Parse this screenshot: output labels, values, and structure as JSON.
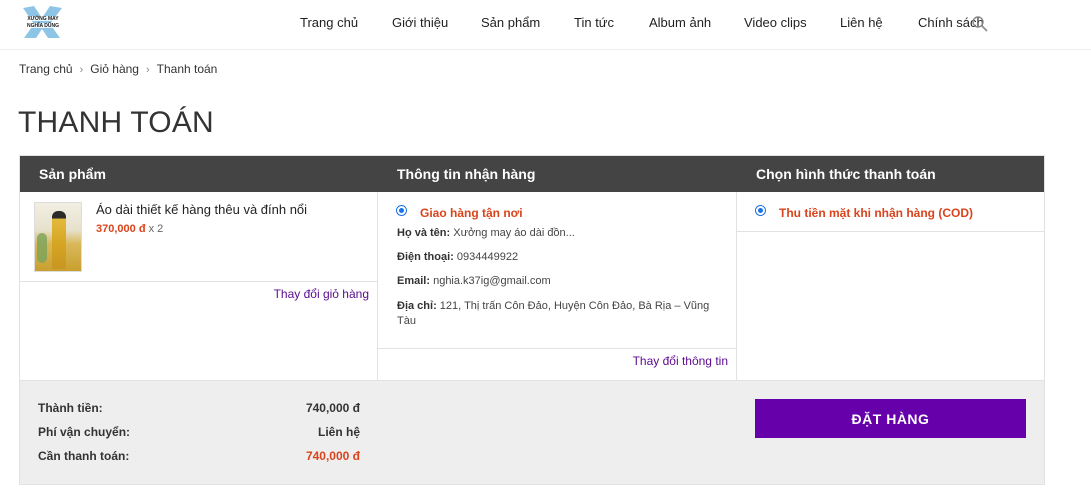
{
  "header": {
    "logo_alt": "XƯỞNG MAY NGHĨA DŨNG",
    "nav": [
      "Trang chủ",
      "Giới thiệu",
      "Sản phẩm",
      "Tin tức",
      "Album ảnh",
      "Video clips",
      "Liên hệ",
      "Chính sách"
    ],
    "search_icon": "search-icon"
  },
  "breadcrumb": [
    "Trang chủ",
    "Giỏ hàng",
    "Thanh toán"
  ],
  "page_title": "THANH TOÁN",
  "columns": {
    "products": "Sản phẩm",
    "shipping": "Thông tin nhận hàng",
    "payment": "Chọn hình thức thanh toán"
  },
  "product": {
    "name": "Áo dài thiết kế hàng thêu và đính nổi",
    "price": "370,000 đ",
    "qty": "x 2",
    "change_cart": "Thay đổi giỏ hàng"
  },
  "shipping": {
    "method": "Giao hàng tận nơi",
    "name_label": "Họ và tên:",
    "name_value": "Xưởng may áo dài đồn...",
    "phone_label": "Điện thoại:",
    "phone_value": "0934449922",
    "email_label": "Email:",
    "email_value": "nghia.k37ig@gmail.com",
    "address_label": "Địa chỉ:",
    "address_value": "121, Thị trấn Côn Đảo, Huyện Côn Đảo, Bà Rịa – Vũng Tàu",
    "change_info": "Thay đổi thông tin"
  },
  "payment": {
    "method": "Thu tiền mặt khi nhận hàng (COD)"
  },
  "summary": {
    "subtotal_label": "Thành tiền:",
    "subtotal_value": "740,000 đ",
    "shipping_label": "Phí vận chuyển:",
    "shipping_value": "Liên hệ",
    "total_label": "Cần thanh toán:",
    "total_value": "740,000 đ"
  },
  "order_button": "ĐẶT HÀNG",
  "colors": {
    "accent": "#6600aa",
    "price": "#d9441c",
    "header_bg": "#444444",
    "link": "#5b0a8f"
  }
}
